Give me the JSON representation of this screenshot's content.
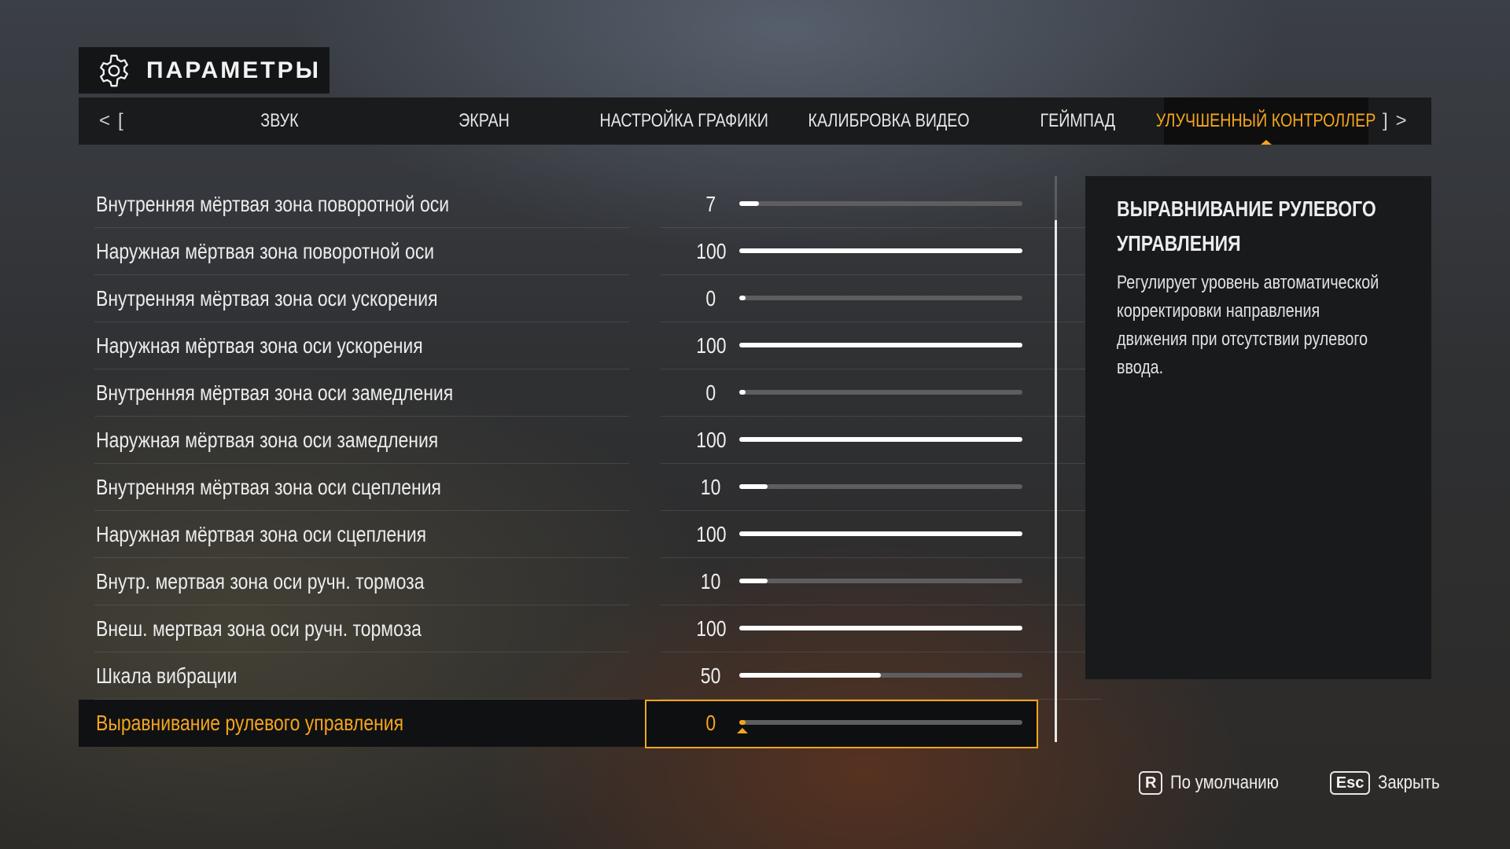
{
  "header": {
    "title": "ПАРАМЕТРЫ",
    "icon": "gear-icon"
  },
  "tabs": {
    "prev_arrow": "<",
    "prev_bracket": "[",
    "next_bracket": "]",
    "next_arrow": ">",
    "items": [
      {
        "label": "ЗВУК"
      },
      {
        "label": "ЭКРАН"
      },
      {
        "label": "НАСТРОЙКА ГРАФИКИ"
      },
      {
        "label": "КАЛИБРОВКА ВИДЕО"
      },
      {
        "label": "ГЕЙМПАД"
      },
      {
        "label": "УЛУЧШЕННЫЙ КОНТРОЛЛЕР"
      }
    ],
    "active_index": 5
  },
  "settings": [
    {
      "label": "Внутренняя мёртвая зона поворотной оси",
      "value": "7",
      "percent": 7
    },
    {
      "label": "Наружная мёртвая зона поворотной оси",
      "value": "100",
      "percent": 100
    },
    {
      "label": "Внутренняя мёртвая зона оси ускорения",
      "value": "0",
      "percent": 0
    },
    {
      "label": "Наружная мёртвая зона оси ускорения",
      "value": "100",
      "percent": 100
    },
    {
      "label": "Внутренняя мёртвая зона оси замедления",
      "value": "0",
      "percent": 0
    },
    {
      "label": "Наружная мёртвая зона оси замедления",
      "value": "100",
      "percent": 100
    },
    {
      "label": "Внутренняя мёртвая зона оси сцепления",
      "value": "10",
      "percent": 10
    },
    {
      "label": "Наружная мёртвая зона оси сцепления",
      "value": "100",
      "percent": 100
    },
    {
      "label": "Внутр. мертвая зона оси ручн. тормоза",
      "value": "10",
      "percent": 10
    },
    {
      "label": "Внеш. мертвая зона оси ручн. тормоза",
      "value": "100",
      "percent": 100
    },
    {
      "label": "Шкала вибрации",
      "value": "50",
      "percent": 50
    },
    {
      "label": "Выравнивание рулевого управления",
      "value": "0",
      "percent": 0
    }
  ],
  "selected_index": 11,
  "info": {
    "title": "ВЫРАВНИВАНИЕ РУЛЕВОГО УПРАВЛЕНИЯ",
    "description": "Регулирует уровень автоматической корректировки направления движения при отсутствии рулевого ввода."
  },
  "footer": {
    "default_key": "R",
    "default_label": "По умолчанию",
    "close_key": "Esc",
    "close_label": "Закрыть"
  },
  "colors": {
    "accent": "#f4a51c",
    "panel": "#191a1c",
    "track": "#5e5e60"
  }
}
